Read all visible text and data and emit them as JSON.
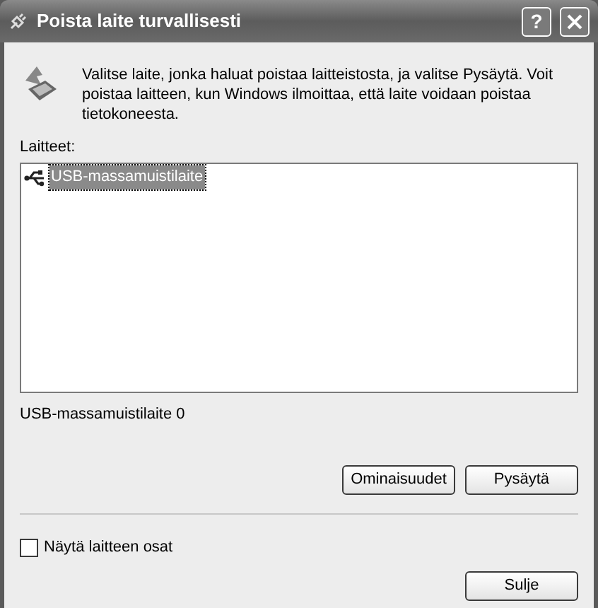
{
  "window": {
    "title": "Poista laite turvallisesti",
    "help_button": "?"
  },
  "instructions": "Valitse laite, jonka haluat poistaa laitteistosta, ja valitse Pysäytä. Voit poistaa laitteen, kun Windows ilmoittaa, että laite voidaan poistaa tietokoneesta.",
  "devices": {
    "label": "Laitteet:",
    "items": [
      {
        "name": "USB-massamuistilaite",
        "selected": true
      }
    ]
  },
  "selected_device": "USB-massamuistilaite 0",
  "action_buttons": [
    "Ominaisuudet",
    "Pysäytä"
  ],
  "show_components": {
    "label": "Näytä laitteen osat",
    "checked": false
  },
  "close_button": "Sulje"
}
